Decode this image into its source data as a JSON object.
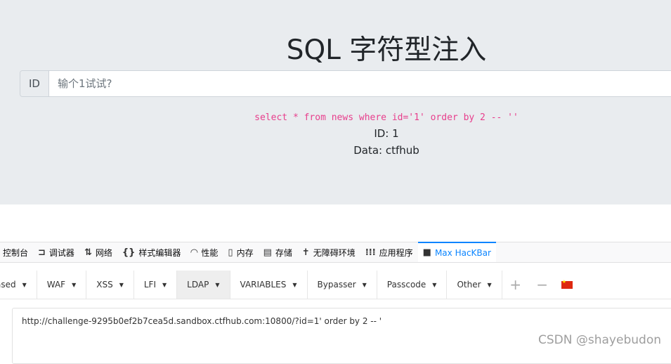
{
  "page": {
    "title": "SQL 字符型注入",
    "id_prefix": "ID",
    "id_placeholder": "输个1试试?",
    "sql_query": "select * from news where id='1' order by 2 -- ''",
    "id_line": "ID: 1",
    "data_line": "Data: ctfhub"
  },
  "devtools": {
    "tabs": [
      {
        "label": "控制台",
        "icon": "console-icon",
        "active": false
      },
      {
        "label": "调试器",
        "icon": "debugger-icon",
        "active": false
      },
      {
        "label": "网络",
        "icon": "network-icon",
        "active": false
      },
      {
        "label": "样式编辑器",
        "icon": "style-editor-icon",
        "active": false
      },
      {
        "label": "性能",
        "icon": "performance-icon",
        "active": false
      },
      {
        "label": "内存",
        "icon": "memory-icon",
        "active": false
      },
      {
        "label": "存储",
        "icon": "storage-icon",
        "active": false
      },
      {
        "label": "无障碍环境",
        "icon": "accessibility-icon",
        "active": false
      },
      {
        "label": "应用程序",
        "icon": "application-icon",
        "active": false
      },
      {
        "label": "Max HacKBar",
        "icon": "hackbar-icon",
        "active": true
      }
    ]
  },
  "hackbar": {
    "menus": [
      "ased",
      "WAF",
      "XSS",
      "LFI",
      "LDAP",
      "VARIABLES",
      "Bypasser",
      "Passcode",
      "Other"
    ],
    "active_menu": "LDAP",
    "url": "http://challenge-9295b0ef2b7cea5d.sandbox.ctfhub.com:10800/?id=1' order by 2 -- '"
  },
  "watermark": "CSDN @shayebudon",
  "colors": {
    "accent": "#0a84ff",
    "sql": "#e83e8c",
    "jumbotron": "#e9ecef"
  }
}
